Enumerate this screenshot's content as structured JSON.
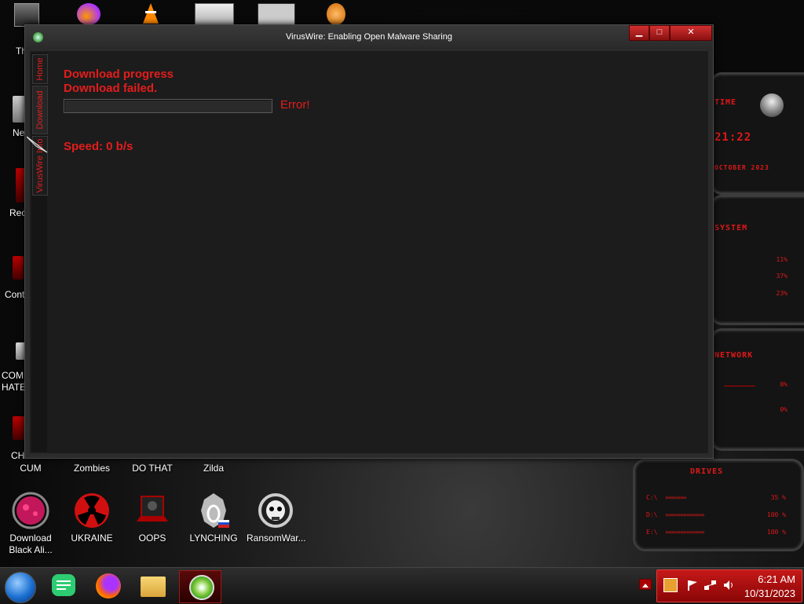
{
  "window": {
    "title": "VirusWire: Enabling Open Malware Sharing",
    "minimize_glyph": "▁",
    "maximize_glyph": "□",
    "close_glyph": "✕"
  },
  "tabs": [
    {
      "label": "Home"
    },
    {
      "label": "Download"
    },
    {
      "label": "VirusWire Info"
    }
  ],
  "download": {
    "progress_title": "Download progress",
    "status": "Download failed.",
    "progress": 0,
    "error": "Error!",
    "speed": "Speed: 0 b/s"
  },
  "desktop": {
    "left_labels": [
      "Th",
      "Ne",
      "Rec",
      "Cont",
      "COMI",
      "HATE",
      "CH"
    ],
    "row1_labels": [
      "CUM",
      "Zombies",
      "DO THAT",
      "Zilda"
    ],
    "icons": [
      {
        "label": "Download Black Ali...",
        "icon": "virus-icon"
      },
      {
        "label": "UKRAINE",
        "icon": "radiation-icon"
      },
      {
        "label": "OOPS",
        "icon": "laptop-icon"
      },
      {
        "label": "LYNCHING",
        "icon": "noose-icon"
      },
      {
        "label": "RansomWar...",
        "icon": "skull-icon"
      }
    ]
  },
  "widgets": {
    "time_title": "TIME",
    "time_value": "21:22",
    "date_text": "OCTOBER 2023",
    "system_title": "SYSTEM",
    "system_values": [
      "11%",
      "37%",
      "23%"
    ],
    "network_title": "NETWORK",
    "network_values": [
      "0%",
      "0%"
    ],
    "drives_title": "DRIVES",
    "drives": [
      {
        "letter": "C:\\",
        "pct": "35 %"
      },
      {
        "letter": "D:\\",
        "pct": "100 %"
      },
      {
        "letter": "E:\\",
        "pct": "100 %"
      }
    ]
  },
  "taskbar": {
    "time": "6:21 AM",
    "date": "10/31/2023"
  },
  "colors": {
    "accent": "#e51c1c",
    "window_bg": "#1c1c1c"
  }
}
